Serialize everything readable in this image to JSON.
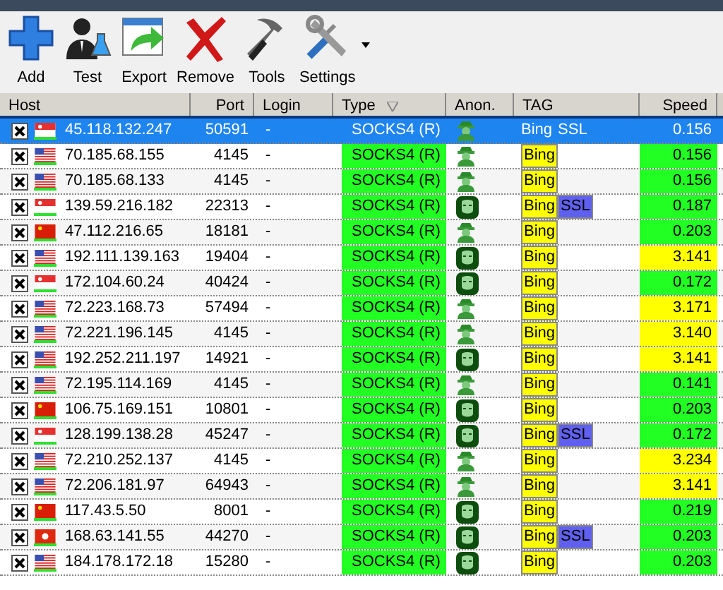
{
  "toolbar": [
    {
      "label": "Add",
      "kind": "add"
    },
    {
      "label": "Test",
      "kind": "test"
    },
    {
      "label": "Export",
      "kind": "export"
    },
    {
      "label": "Remove",
      "kind": "remove"
    },
    {
      "label": "Tools",
      "kind": "tools"
    },
    {
      "label": "Settings",
      "kind": "settings",
      "dropdown": true
    }
  ],
  "columns": [
    {
      "label": "Host",
      "sorted": false
    },
    {
      "label": "Port",
      "sorted": false
    },
    {
      "label": "Login",
      "sorted": false
    },
    {
      "label": "Type",
      "sorted": true
    },
    {
      "label": "Anon.",
      "sorted": false
    },
    {
      "label": "TAG",
      "sorted": false
    },
    {
      "label": "Speed",
      "sorted": false
    }
  ],
  "rows": [
    {
      "selected": true,
      "checked": true,
      "flag": {
        "kind": "sg"
      },
      "host": "45.118.132.247",
      "port": "50591",
      "login": "-",
      "type": "SOCKS4 (R)",
      "anon": {
        "kind": "spy"
      },
      "tags": [
        "Bing",
        "SSL"
      ],
      "speed": "0.156"
    },
    {
      "selected": false,
      "checked": true,
      "flag": {
        "kind": "us"
      },
      "host": "70.185.68.155",
      "port": "4145",
      "login": "-",
      "type": "SOCKS4 (R)",
      "anon": {
        "kind": "spy"
      },
      "tags": [
        "Bing"
      ],
      "speed": "0.156",
      "color": "#22ff22"
    },
    {
      "selected": false,
      "checked": true,
      "flag": {
        "kind": "us"
      },
      "host": "70.185.68.133",
      "port": "4145",
      "login": "-",
      "type": "SOCKS4 (R)",
      "anon": {
        "kind": "spy"
      },
      "tags": [
        "Bing"
      ],
      "speed": "0.156",
      "color": "#22ff22"
    },
    {
      "selected": false,
      "checked": true,
      "flag": {
        "kind": "sg"
      },
      "host": "139.59.216.182",
      "port": "22313",
      "login": "-",
      "type": "SOCKS4 (R)",
      "anon": {
        "kind": "mask"
      },
      "tags": [
        "Bing",
        "SSL"
      ],
      "speed": "0.187",
      "color": "#22ff22"
    },
    {
      "selected": false,
      "checked": true,
      "flag": {
        "kind": "cn"
      },
      "host": "47.112.216.65",
      "port": "18181",
      "login": "-",
      "type": "SOCKS4 (R)",
      "anon": {
        "kind": "spy"
      },
      "tags": [
        "Bing"
      ],
      "speed": "0.203",
      "color": "#22ff22"
    },
    {
      "selected": false,
      "checked": true,
      "flag": {
        "kind": "us"
      },
      "host": "192.111.139.163",
      "port": "19404",
      "login": "-",
      "type": "SOCKS4 (R)",
      "anon": {
        "kind": "mask"
      },
      "tags": [
        "Bing"
      ],
      "speed": "3.141",
      "color": "#ffff00"
    },
    {
      "selected": false,
      "checked": true,
      "flag": {
        "kind": "sg"
      },
      "host": "172.104.60.24",
      "port": "40424",
      "login": "-",
      "type": "SOCKS4 (R)",
      "anon": {
        "kind": "mask"
      },
      "tags": [
        "Bing"
      ],
      "speed": "0.172",
      "color": "#22ff22"
    },
    {
      "selected": false,
      "checked": true,
      "flag": {
        "kind": "us"
      },
      "host": "72.223.168.73",
      "port": "57494",
      "login": "-",
      "type": "SOCKS4 (R)",
      "anon": {
        "kind": "spy"
      },
      "tags": [
        "Bing"
      ],
      "speed": "3.171",
      "color": "#ffff00"
    },
    {
      "selected": false,
      "checked": true,
      "flag": {
        "kind": "us"
      },
      "host": "72.221.196.145",
      "port": "4145",
      "login": "-",
      "type": "SOCKS4 (R)",
      "anon": {
        "kind": "spy"
      },
      "tags": [
        "Bing"
      ],
      "speed": "3.140",
      "color": "#ffff00"
    },
    {
      "selected": false,
      "checked": true,
      "flag": {
        "kind": "us"
      },
      "host": "192.252.211.197",
      "port": "14921",
      "login": "-",
      "type": "SOCKS4 (R)",
      "anon": {
        "kind": "mask"
      },
      "tags": [
        "Bing"
      ],
      "speed": "3.141",
      "color": "#ffff00"
    },
    {
      "selected": false,
      "checked": true,
      "flag": {
        "kind": "us"
      },
      "host": "72.195.114.169",
      "port": "4145",
      "login": "-",
      "type": "SOCKS4 (R)",
      "anon": {
        "kind": "spy"
      },
      "tags": [
        "Bing"
      ],
      "speed": "0.141",
      "color": "#22ff22"
    },
    {
      "selected": false,
      "checked": true,
      "flag": {
        "kind": "cn"
      },
      "host": "106.75.169.151",
      "port": "10801",
      "login": "-",
      "type": "SOCKS4 (R)",
      "anon": {
        "kind": "mask"
      },
      "tags": [
        "Bing"
      ],
      "speed": "0.203",
      "color": "#22ff22"
    },
    {
      "selected": false,
      "checked": true,
      "flag": {
        "kind": "sg"
      },
      "host": "128.199.138.28",
      "port": "45247",
      "login": "-",
      "type": "SOCKS4 (R)",
      "anon": {
        "kind": "mask"
      },
      "tags": [
        "Bing",
        "SSL"
      ],
      "speed": "0.172",
      "color": "#22ff22"
    },
    {
      "selected": false,
      "checked": true,
      "flag": {
        "kind": "us"
      },
      "host": "72.210.252.137",
      "port": "4145",
      "login": "-",
      "type": "SOCKS4 (R)",
      "anon": {
        "kind": "spy"
      },
      "tags": [
        "Bing"
      ],
      "speed": "3.234",
      "color": "#ffff00"
    },
    {
      "selected": false,
      "checked": true,
      "flag": {
        "kind": "us"
      },
      "host": "72.206.181.97",
      "port": "64943",
      "login": "-",
      "type": "SOCKS4 (R)",
      "anon": {
        "kind": "spy"
      },
      "tags": [
        "Bing"
      ],
      "speed": "3.141",
      "color": "#ffff00"
    },
    {
      "selected": false,
      "checked": true,
      "flag": {
        "kind": "cn"
      },
      "host": "117.43.5.50",
      "port": "8001",
      "login": "-",
      "type": "SOCKS4 (R)",
      "anon": {
        "kind": "mask"
      },
      "tags": [
        "Bing"
      ],
      "speed": "0.219",
      "color": "#22ff22"
    },
    {
      "selected": false,
      "checked": true,
      "flag": {
        "kind": "hk"
      },
      "host": "168.63.141.55",
      "port": "44270",
      "login": "-",
      "type": "SOCKS4 (R)",
      "anon": {
        "kind": "mask"
      },
      "tags": [
        "Bing",
        "SSL"
      ],
      "speed": "0.203",
      "color": "#22ff22"
    },
    {
      "selected": false,
      "checked": true,
      "flag": {
        "kind": "us"
      },
      "host": "184.178.172.18",
      "port": "15280",
      "login": "-",
      "type": "SOCKS4 (R)",
      "anon": {
        "kind": "mask"
      },
      "tags": [
        "Bing"
      ],
      "speed": "0.203",
      "color": "#22ff22"
    }
  ]
}
